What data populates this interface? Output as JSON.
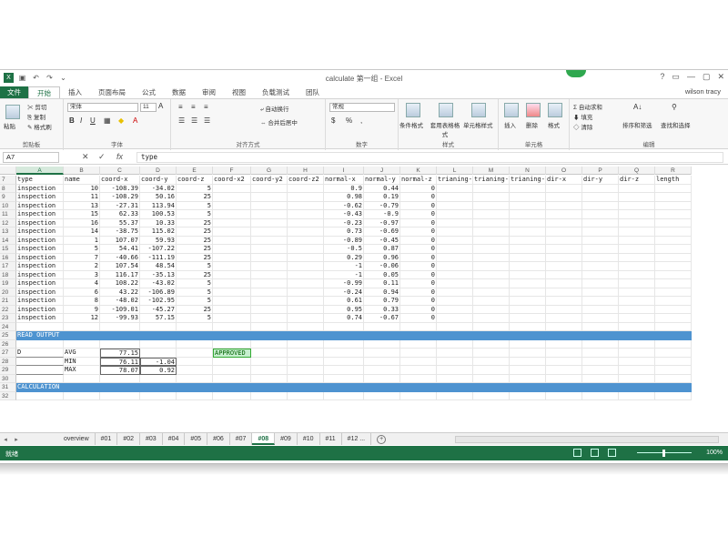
{
  "window": {
    "title": "calculate 第一组 - Excel",
    "user": "wilson tracy",
    "controls": [
      "?",
      "▭",
      "—",
      "▢",
      "✕"
    ]
  },
  "ribbon_tabs": [
    "文件",
    "开始",
    "插入",
    "页面布局",
    "公式",
    "数据",
    "审阅",
    "视图",
    "负载测试",
    "团队"
  ],
  "ribbon": {
    "clipboard": {
      "paste": "粘贴",
      "cut": "剪切",
      "copy": "复制",
      "format_painter": "格式刷",
      "label": "剪贴板"
    },
    "font": {
      "name": "宋体",
      "size": "11",
      "label": "字体"
    },
    "alignment": {
      "wrap": "自动换行",
      "merge": "合并后居中",
      "label": "对齐方式"
    },
    "number": {
      "format": "常规",
      "label": "数字"
    },
    "styles": {
      "conditional": "条件格式",
      "table": "套用表格格式",
      "cell": "单元格样式",
      "label": "样式"
    },
    "cells": {
      "insert": "插入",
      "delete": "删除",
      "format": "格式",
      "label": "单元格"
    },
    "editing": {
      "autosum": "自动求和",
      "fill": "填充",
      "clear": "清除",
      "sort": "排序和筛选",
      "find": "查找和选择",
      "label": "编辑"
    }
  },
  "formula_bar": {
    "name_box": "A7",
    "cancel": "✕",
    "enter": "✓",
    "fx": "fx",
    "formula": "type"
  },
  "columns": [
    "A",
    "B",
    "C",
    "D",
    "E",
    "F",
    "G",
    "H",
    "I",
    "J",
    "K",
    "L",
    "M",
    "N",
    "O",
    "P",
    "Q",
    "R"
  ],
  "rows": [
    {
      "n": "7",
      "cells": [
        "type",
        "name",
        "coord-x",
        "coord-y",
        "coord-z",
        "coord-x2",
        "coord-y2",
        "coord-z2",
        "normal-x",
        "normal-y",
        "normal-z",
        "trianing-",
        "trianing-",
        "trianing-",
        "dir-x",
        "dir-y",
        "dir-z",
        "length"
      ]
    },
    {
      "n": "8",
      "cells": [
        "inspection",
        "10",
        "-108.39",
        "-34.02",
        "5",
        "",
        "",
        "",
        "0.9",
        "0.44",
        "0",
        "",
        "",
        "",
        "",
        "",
        "",
        ""
      ]
    },
    {
      "n": "9",
      "cells": [
        "inspection",
        "11",
        "-108.29",
        "50.16",
        "25",
        "",
        "",
        "",
        "0.98",
        "0.19",
        "0",
        "",
        "",
        "",
        "",
        "",
        "",
        ""
      ]
    },
    {
      "n": "10",
      "cells": [
        "inspection",
        "13",
        "-27.31",
        "113.94",
        "5",
        "",
        "",
        "",
        "-0.62",
        "-0.79",
        "0",
        "",
        "",
        "",
        "",
        "",
        "",
        ""
      ]
    },
    {
      "n": "11",
      "cells": [
        "inspection",
        "15",
        "62.33",
        "100.53",
        "5",
        "",
        "",
        "",
        "-0.43",
        "-0.9",
        "0",
        "",
        "",
        "",
        "",
        "",
        "",
        ""
      ]
    },
    {
      "n": "12",
      "cells": [
        "inspection",
        "16",
        "55.37",
        "10.33",
        "25",
        "",
        "",
        "",
        "-0.23",
        "-0.97",
        "0",
        "",
        "",
        "",
        "",
        "",
        "",
        ""
      ]
    },
    {
      "n": "13",
      "cells": [
        "inspection",
        "14",
        "-38.75",
        "115.02",
        "25",
        "",
        "",
        "",
        "0.73",
        "-0.69",
        "0",
        "",
        "",
        "",
        "",
        "",
        "",
        ""
      ]
    },
    {
      "n": "14",
      "cells": [
        "inspection",
        "1",
        "107.07",
        "59.93",
        "25",
        "",
        "",
        "",
        "-0.89",
        "-0.45",
        "0",
        "",
        "",
        "",
        "",
        "",
        "",
        ""
      ]
    },
    {
      "n": "15",
      "cells": [
        "inspection",
        "5",
        "54.41",
        "-107.22",
        "25",
        "",
        "",
        "",
        "-0.5",
        "0.87",
        "0",
        "",
        "",
        "",
        "",
        "",
        "",
        ""
      ]
    },
    {
      "n": "16",
      "cells": [
        "inspection",
        "7",
        "-40.66",
        "-111.19",
        "25",
        "",
        "",
        "",
        "0.29",
        "0.96",
        "0",
        "",
        "",
        "",
        "",
        "",
        "",
        ""
      ]
    },
    {
      "n": "17",
      "cells": [
        "inspection",
        "2",
        "107.54",
        "48.54",
        "5",
        "",
        "",
        "",
        "-1",
        "-0.06",
        "0",
        "",
        "",
        "",
        "",
        "",
        "",
        ""
      ]
    },
    {
      "n": "18",
      "cells": [
        "inspection",
        "3",
        "116.17",
        "-35.13",
        "25",
        "",
        "",
        "",
        "-1",
        "0.05",
        "0",
        "",
        "",
        "",
        "",
        "",
        "",
        ""
      ]
    },
    {
      "n": "19",
      "cells": [
        "inspection",
        "4",
        "108.22",
        "-43.02",
        "5",
        "",
        "",
        "",
        "-0.99",
        "0.11",
        "0",
        "",
        "",
        "",
        "",
        "",
        "",
        ""
      ]
    },
    {
      "n": "20",
      "cells": [
        "inspection",
        "6",
        "43.22",
        "-106.89",
        "5",
        "",
        "",
        "",
        "-0.24",
        "0.94",
        "0",
        "",
        "",
        "",
        "",
        "",
        "",
        ""
      ]
    },
    {
      "n": "21",
      "cells": [
        "inspection",
        "8",
        "-48.02",
        "-102.95",
        "5",
        "",
        "",
        "",
        "0.61",
        "0.79",
        "0",
        "",
        "",
        "",
        "",
        "",
        "",
        ""
      ]
    },
    {
      "n": "22",
      "cells": [
        "inspection",
        "9",
        "-109.01",
        "-45.27",
        "25",
        "",
        "",
        "",
        "0.95",
        "0.33",
        "0",
        "",
        "",
        "",
        "",
        "",
        "",
        ""
      ]
    },
    {
      "n": "23",
      "cells": [
        "inspection",
        "12",
        "-99.93",
        "57.15",
        "5",
        "",
        "",
        "",
        "0.74",
        "-0.67",
        "0",
        "",
        "",
        "",
        "",
        "",
        "",
        ""
      ]
    },
    {
      "n": "24",
      "cells": [
        "",
        "",
        "",
        "",
        "",
        "",
        "",
        "",
        "",
        "",
        "",
        "",
        "",
        "",
        "",
        "",
        "",
        ""
      ]
    },
    {
      "n": "25",
      "cells": [
        "READ OUTPUT",
        "",
        "",
        "",
        "",
        "",
        "",
        "",
        "",
        "",
        "",
        "",
        "",
        "",
        "",
        "",
        "",
        ""
      ],
      "band": true
    },
    {
      "n": "26",
      "cells": [
        "",
        "",
        "",
        "",
        "",
        "",
        "",
        "",
        "",
        "",
        "",
        "",
        "",
        "",
        "",
        "",
        "",
        ""
      ]
    },
    {
      "n": "27",
      "cells": [
        "D",
        "AVG",
        "77.15",
        "",
        "",
        "APPROVED",
        "",
        "",
        "",
        "",
        "",
        "",
        "",
        "",
        "",
        "",
        "",
        ""
      ]
    },
    {
      "n": "28",
      "cells": [
        "",
        "MIN",
        "76.11",
        "-1.04",
        "",
        "",
        "",
        "",
        "",
        "",
        "",
        "",
        "",
        "",
        "",
        "",
        "",
        ""
      ]
    },
    {
      "n": "29",
      "cells": [
        "",
        "MAX",
        "78.07",
        "0.92",
        "",
        "",
        "",
        "",
        "",
        "",
        "",
        "",
        "",
        "",
        "",
        "",
        "",
        ""
      ]
    },
    {
      "n": "30",
      "cells": [
        "",
        "",
        "",
        "",
        "",
        "",
        "",
        "",
        "",
        "",
        "",
        "",
        "",
        "",
        "",
        "",
        "",
        ""
      ]
    },
    {
      "n": "31",
      "cells": [
        "CALCULATION STEPS",
        "",
        "",
        "",
        "",
        "",
        "",
        "",
        "",
        "",
        "",
        "",
        "",
        "",
        "",
        "",
        "",
        ""
      ],
      "band": true
    },
    {
      "n": "32",
      "cells": [
        "",
        "",
        "",
        "",
        "",
        "",
        "",
        "",
        "",
        "",
        "",
        "",
        "",
        "",
        "",
        "",
        "",
        ""
      ]
    }
  ],
  "sheet_tabs": [
    "overview",
    "#01",
    "#02",
    "#03",
    "#04",
    "#05",
    "#06",
    "#07",
    "#08",
    "#09",
    "#10",
    "#11",
    "#12 ..."
  ],
  "active_sheet": "#08",
  "status": {
    "ready": "就绪",
    "zoom": "100%"
  },
  "colors": {
    "excel_green": "#1e7145",
    "band_blue": "#4e93d0",
    "approved_fill": "#c6efce"
  }
}
